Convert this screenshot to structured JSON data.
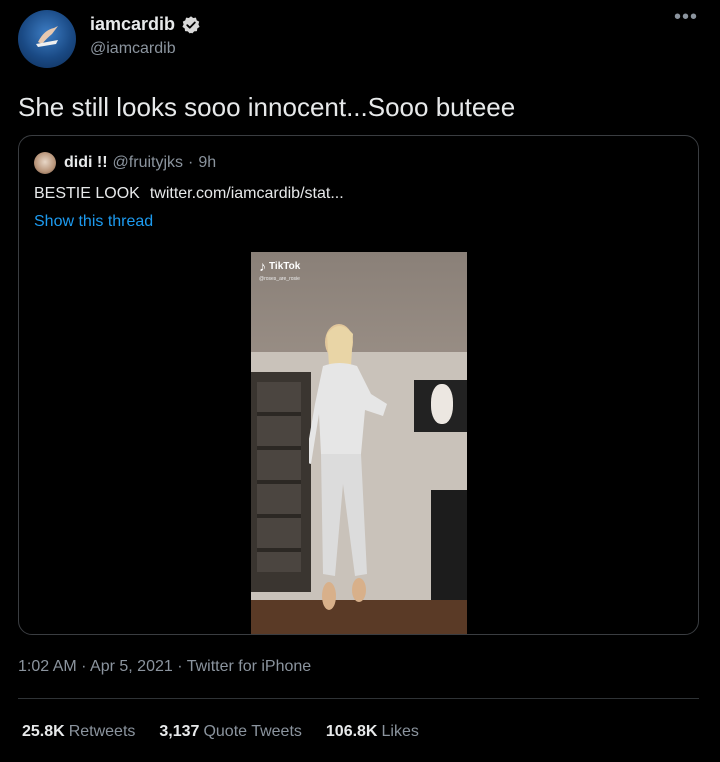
{
  "author": {
    "display_name": "iamcardib",
    "handle": "@iamcardib",
    "verified": true
  },
  "more_icon": "•••",
  "tweet": {
    "text": "She still looks sooo innocent...Sooo buteee"
  },
  "quoted_tweet": {
    "display_name": "didi !!",
    "handle": "@fruityjks",
    "separator": "·",
    "time": "9h",
    "text": "BESTIE LOOK",
    "link": "twitter.com/iamcardib/stat...",
    "show_thread": "Show this thread",
    "media": {
      "brand": "TikTok",
      "username": "@roses_are_rosie"
    }
  },
  "meta": {
    "text": "1:02 AM · Apr 5, 2021 · Twitter for iPhone"
  },
  "stats": [
    {
      "value": "25.8K",
      "label": "Retweets"
    },
    {
      "value": "3,137",
      "label": "Quote Tweets"
    },
    {
      "value": "106.8K",
      "label": "Likes"
    }
  ],
  "colors": {
    "background": "#000000",
    "link": "#1d9bf0",
    "verified": "#d9d9d9",
    "secondary_text": "#8b949e"
  }
}
